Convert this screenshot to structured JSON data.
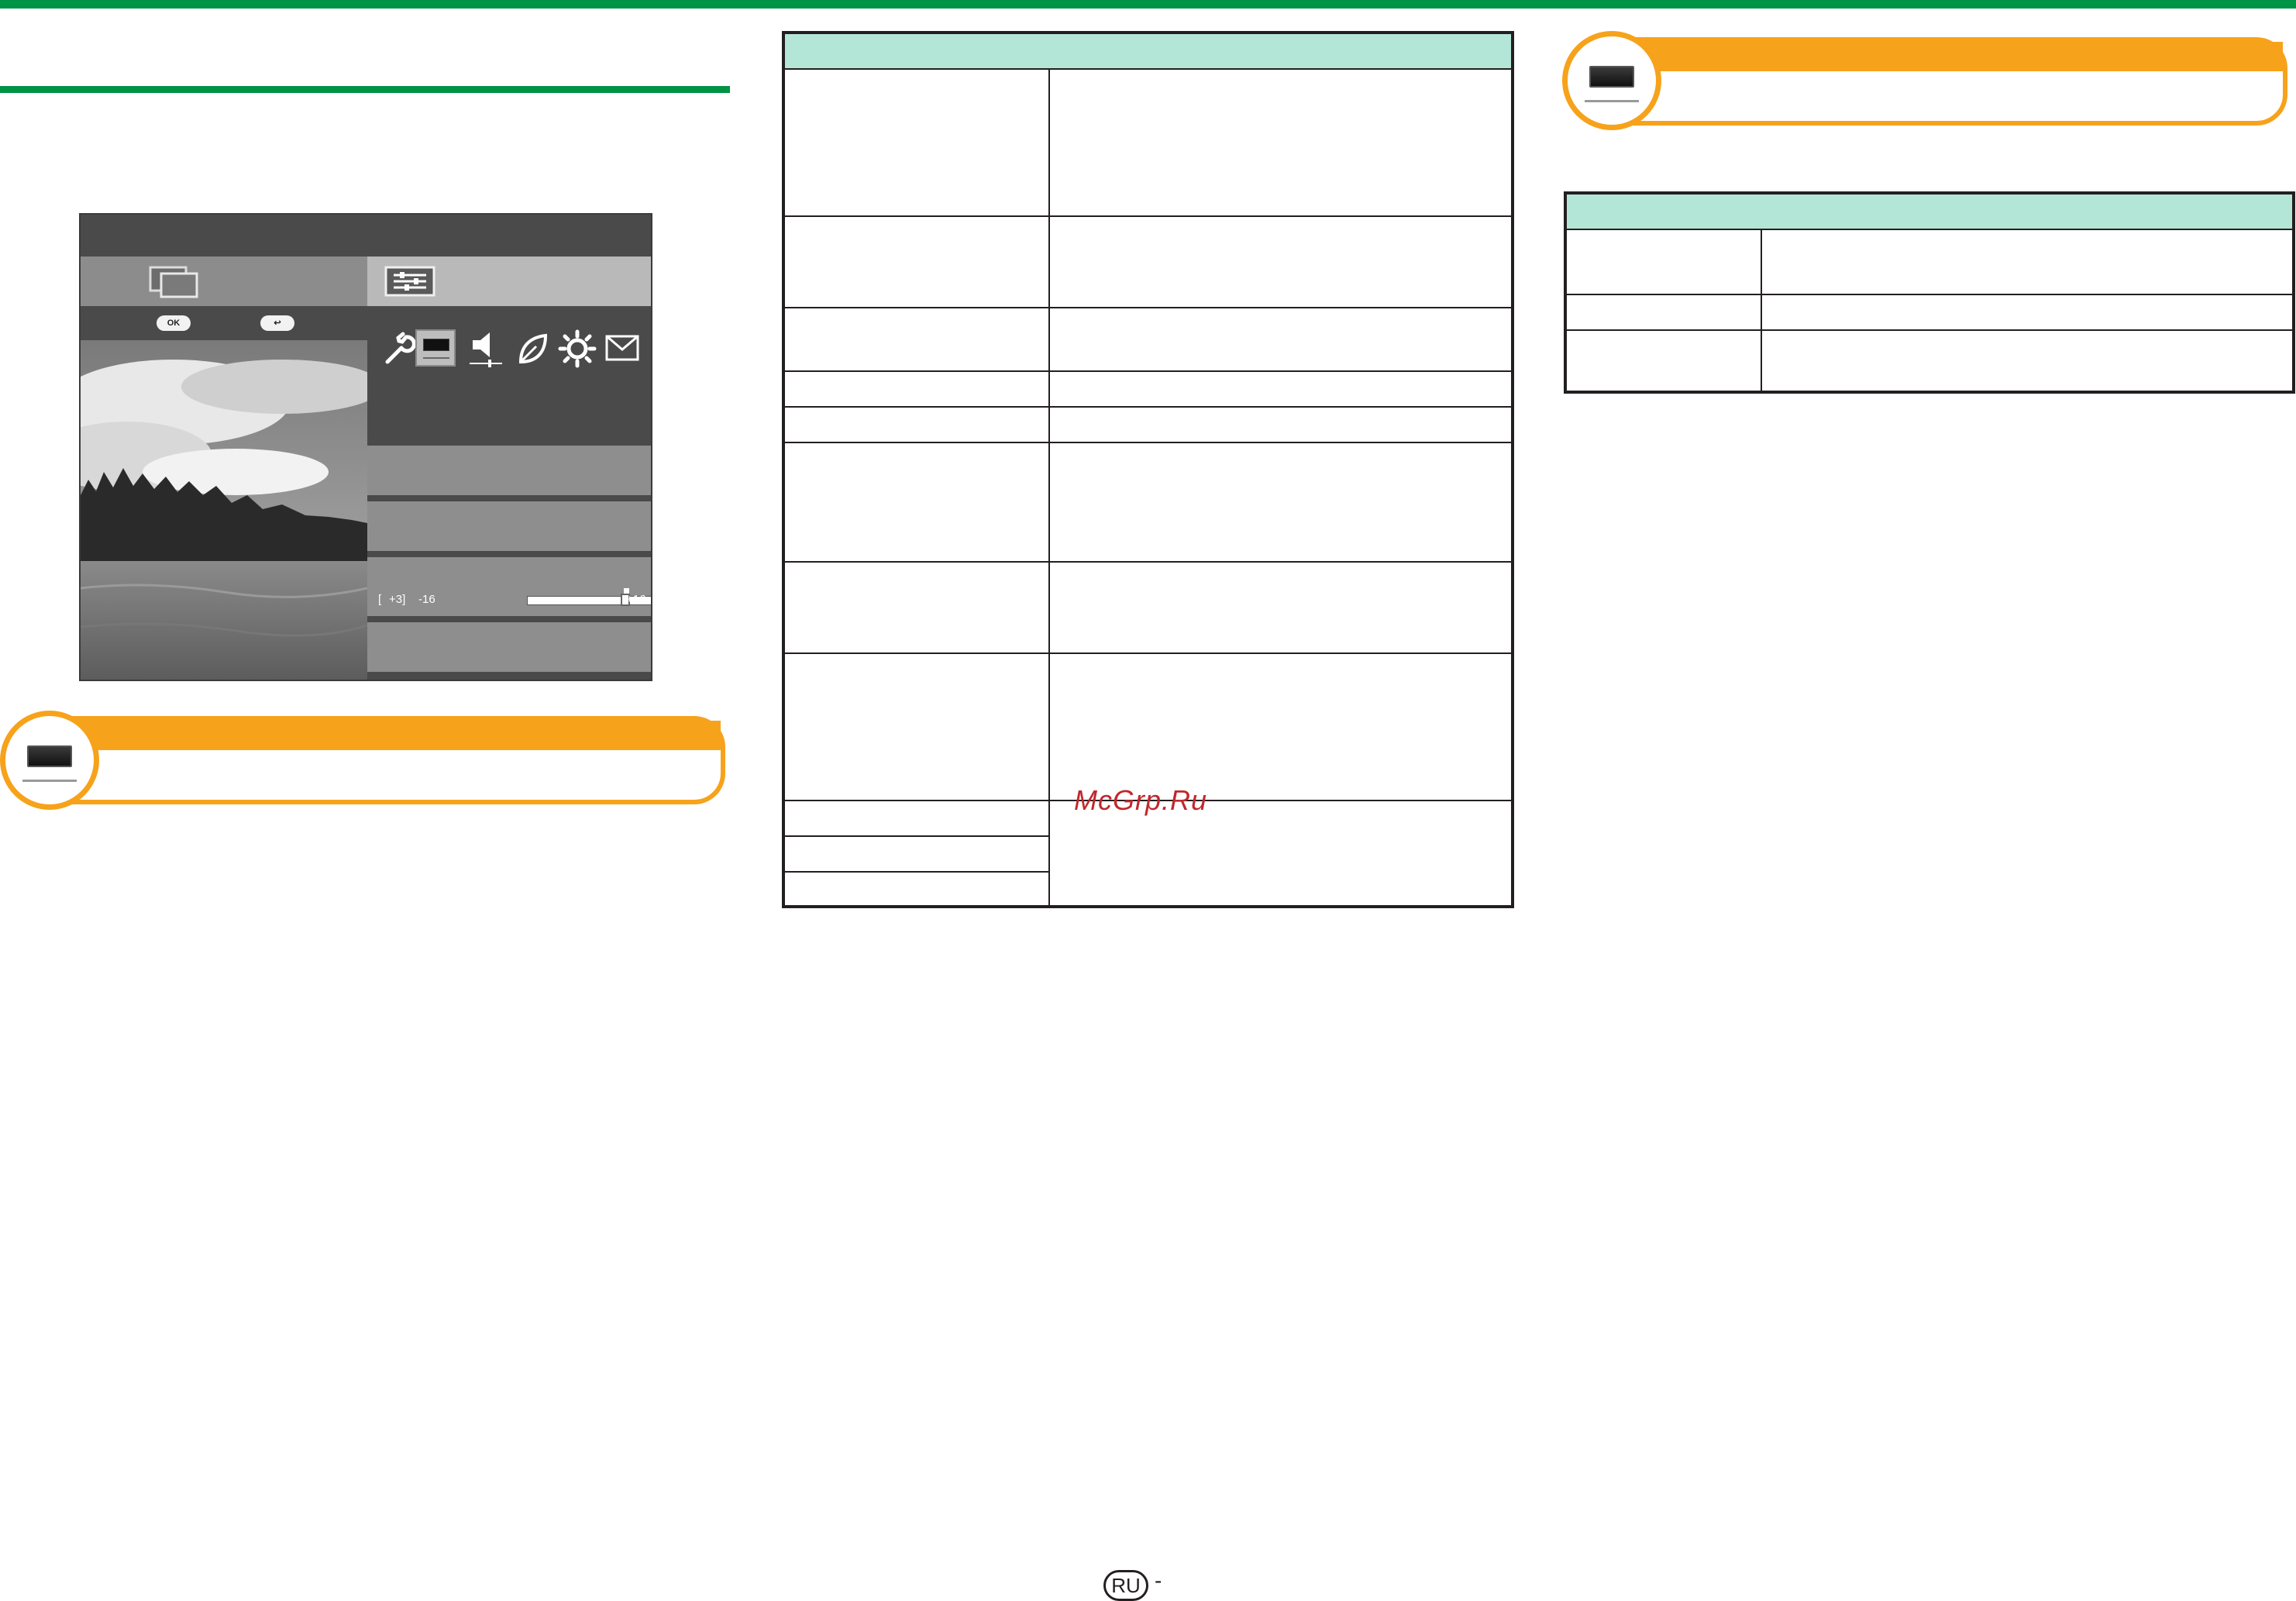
{
  "slider": {
    "bracket_open": "[",
    "current": "+3]",
    "min": "-16",
    "max": "+16",
    "level_fraction": 0.59
  },
  "tv_hint": {
    "ok_label": "OK",
    "back_label": "↩"
  },
  "tv_icons": [
    "wrench-icon",
    "picture-icon",
    "speaker-icon",
    "leaf-icon",
    "gear-icon",
    "envelope-icon"
  ],
  "watermark": "McGrp.Ru",
  "footer": {
    "country_badge": "RU",
    "dash": "-"
  },
  "colors": {
    "accent_green": "#009245",
    "accent_orange": "#f7a21b",
    "table_header": "#b4e6d7"
  }
}
